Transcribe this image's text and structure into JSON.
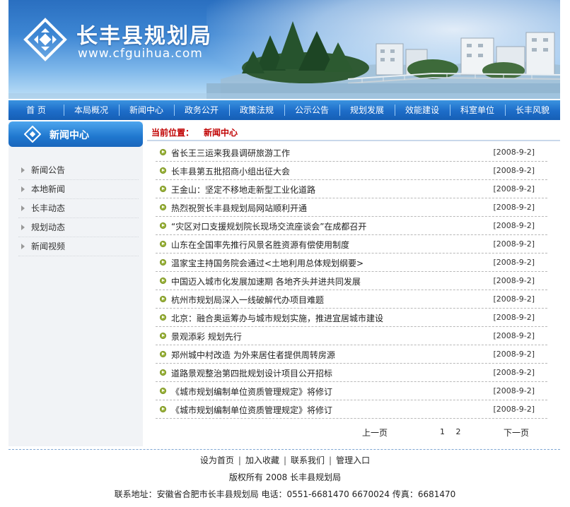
{
  "header": {
    "title": "长丰县规划局",
    "url": "www.cfguihua.com"
  },
  "nav": {
    "items": [
      "首 页",
      "本局概况",
      "新闻中心",
      "政务公开",
      "政策法规",
      "公示公告",
      "规划发展",
      "效能建设",
      "科室单位",
      "长丰风貌"
    ]
  },
  "sidebar": {
    "heading": "新闻中心",
    "items": [
      "新闻公告",
      "本地新闻",
      "长丰动态",
      "规划动态",
      "新闻视频"
    ]
  },
  "breadcrumb": {
    "label": "当前位置：",
    "current": "新闻中心"
  },
  "news": [
    {
      "title": "省长王三运来我县调研旅游工作",
      "date": "[2008-9-2]"
    },
    {
      "title": "长丰县第五批招商小组出征大会",
      "date": "[2008-9-2]"
    },
    {
      "title": "王金山：坚定不移地走新型工业化道路",
      "date": "[2008-9-2]"
    },
    {
      "title": "热烈祝贺长丰县规划局网站顺利开通",
      "date": "[2008-9-2]"
    },
    {
      "title": "“灾区对口支援规划院长现场交流座谈会”在成都召开",
      "date": "[2008-9-2]"
    },
    {
      "title": "山东在全国率先推行风景名胜资源有偿使用制度",
      "date": "[2008-9-2]"
    },
    {
      "title": "温家宝主持国务院会通过<土地利用总体规划纲要>",
      "date": "[2008-9-2]"
    },
    {
      "title": "中国迈入城市化发展加速期 各地齐头并进共同发展",
      "date": "[2008-9-2]"
    },
    {
      "title": "杭州市规划局深入一线破解代办项目难题",
      "date": "[2008-9-2]"
    },
    {
      "title": "北京：融合奥运筹办与城市规划实施，推进宜居城市建设",
      "date": "[2008-9-2]"
    },
    {
      "title": "景观添彩 规划先行",
      "date": "[2008-9-2]"
    },
    {
      "title": "郑州城中村改造 为外来居住者提供周转房源",
      "date": "[2008-9-2]"
    },
    {
      "title": "道路景观整治第四批规划设计项目公开招标",
      "date": "[2008-9-2]"
    },
    {
      "title": "《城市规划编制单位资质管理规定》将修订",
      "date": "[2008-9-2]"
    },
    {
      "title": "《城市规划编制单位资质管理规定》将修订",
      "date": "[2008-9-2]"
    }
  ],
  "pager": {
    "prev": "上一页",
    "pages": "1 2",
    "next": "下一页"
  },
  "footer": {
    "links": [
      "设为首页",
      "加入收藏",
      "联系我们",
      "管理入口"
    ],
    "separator": "|",
    "copyright": "版权所有 2008 长丰县规划局",
    "contact": "联系地址：安徽省合肥市长丰县规划局 电话：0551-6681470 6670024 传真：6681470"
  },
  "colors": {
    "nav_blue": "#1d6cc8",
    "crumb_red": "#c00000",
    "bullet_green": "#9bb43c",
    "sidebar_bg": "#f1f3f6"
  }
}
